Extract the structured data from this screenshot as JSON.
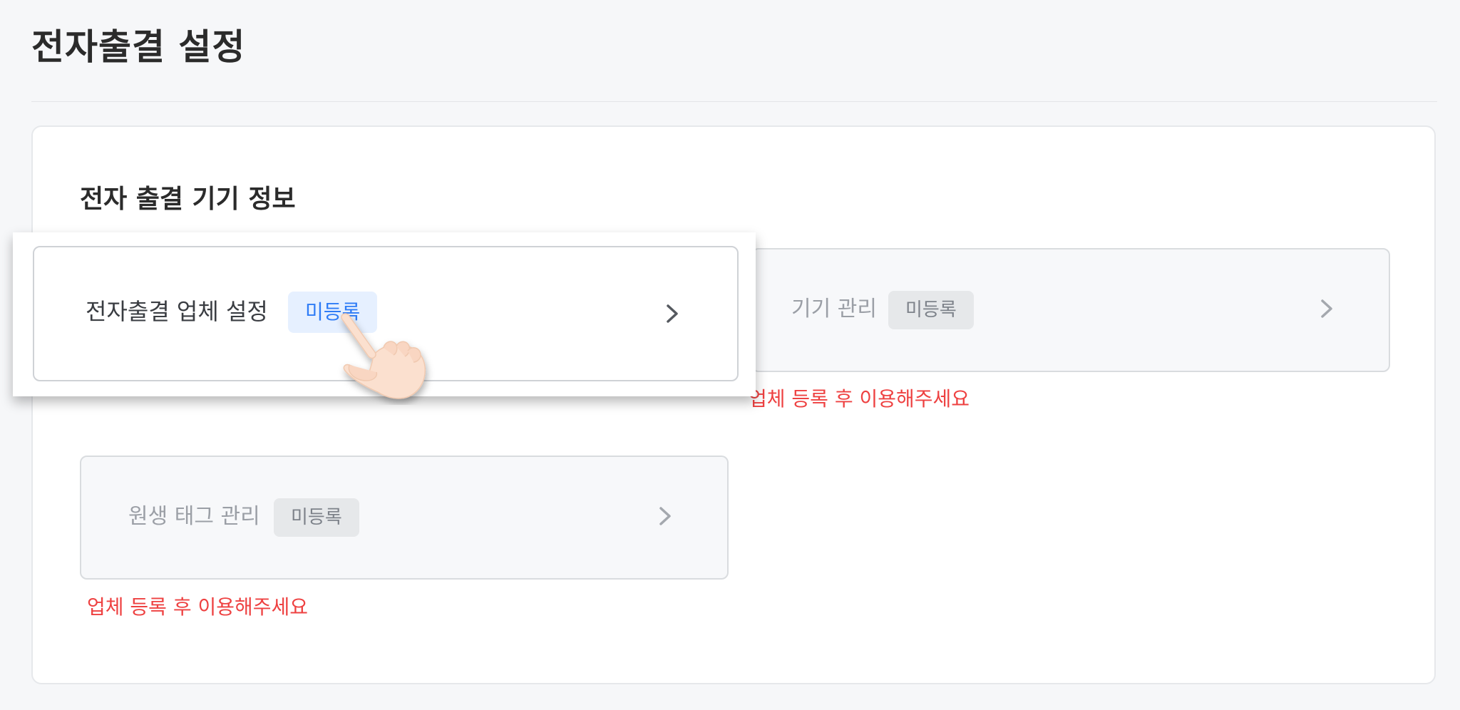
{
  "page": {
    "title": "전자출결 설정"
  },
  "section": {
    "title": "전자 출결 기기 정보"
  },
  "cards": {
    "vendor": {
      "label": "전자출결 업체 설정",
      "badge": "미등록",
      "icon": "chevron-right-icon"
    },
    "device": {
      "label": "기기 관리",
      "badge": "미등록",
      "icon": "chevron-right-icon",
      "warning": "업체 등록 후 이용해주세요"
    },
    "tag": {
      "label": "원생 태그 관리",
      "badge": "미등록",
      "icon": "chevron-right-icon",
      "warning": "업체 등록 후 이용해주세요"
    }
  },
  "colors": {
    "warning": "#ee4141",
    "badge_active_bg": "#e6f0ff",
    "badge_active_text": "#2f7cf6",
    "badge_disabled_bg": "#e6e8ea"
  },
  "overlay": {
    "pointer_icon": "hand-pointer-icon"
  }
}
